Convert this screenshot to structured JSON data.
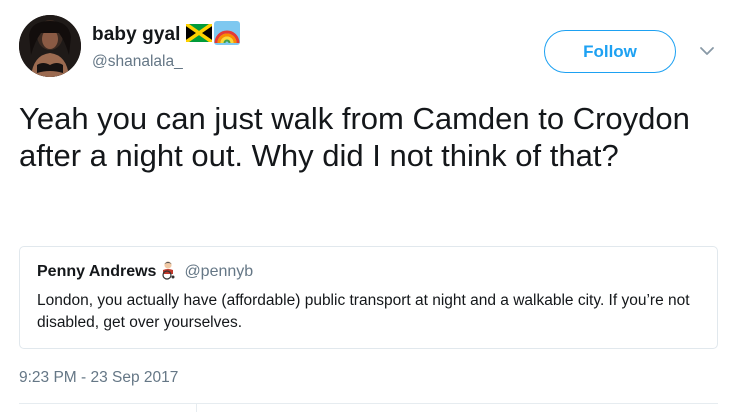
{
  "author": {
    "display_name": "baby gyal",
    "handle": "@shanalala_",
    "name_emojis": [
      "jamaica-flag-icon",
      "rainbow-icon"
    ]
  },
  "actions": {
    "follow_label": "Follow",
    "menu_icon": "chevron-down-icon"
  },
  "tweet": {
    "text": "Yeah you can just walk from Camden to Croydon after a night out. Why did I not think of that?",
    "timestamp": "9:23 PM - 23 Sep 2017"
  },
  "quoted_tweet": {
    "display_name": "Penny Andrews",
    "name_emoji": "wheelchair-user-icon",
    "handle": "@pennyb",
    "text": "London, you actually have (affordable) public transport at night and a walkable city. If you’re not disabled, get over yourselves."
  },
  "colors": {
    "accent": "#1da1f2",
    "secondary_text": "#657786",
    "primary_text": "#14171a",
    "border": "#e1e8ed"
  }
}
